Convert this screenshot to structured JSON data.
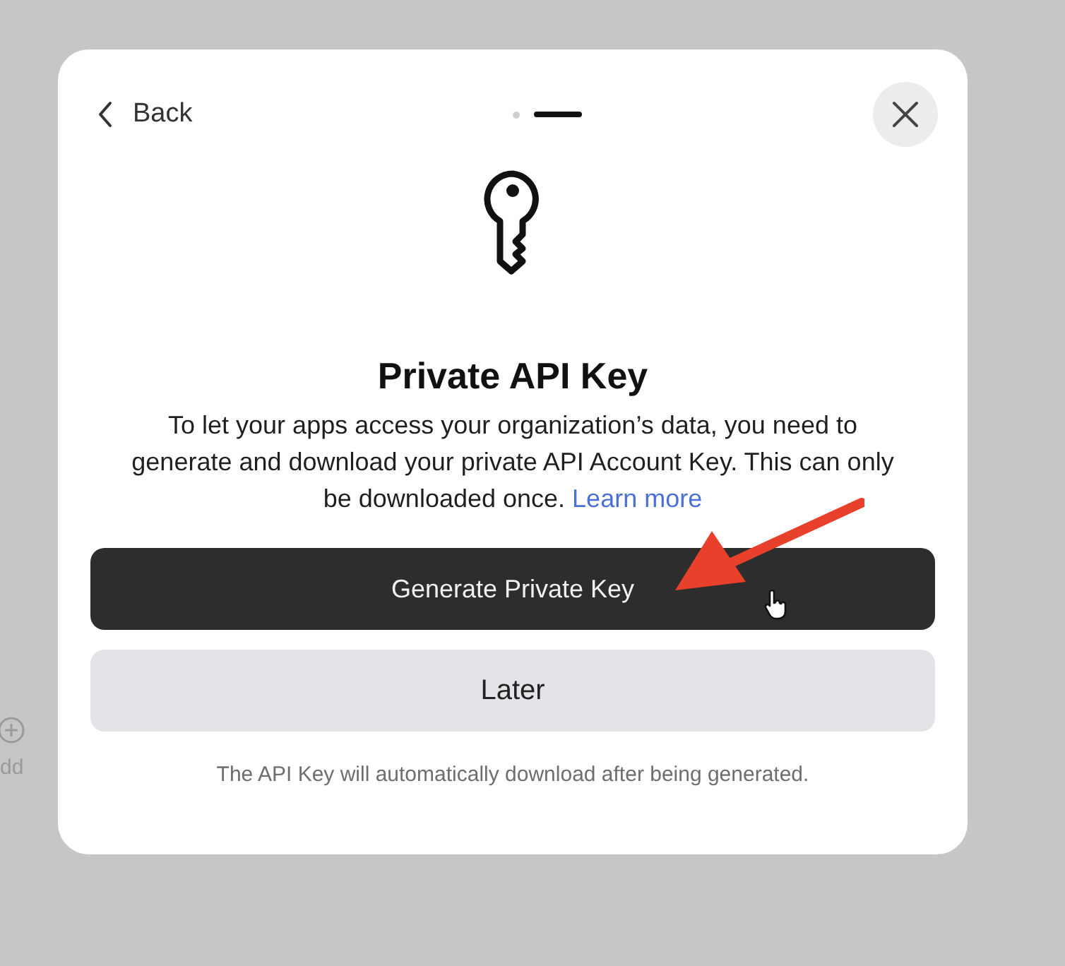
{
  "background": {
    "add_label": "dd"
  },
  "dialog": {
    "back": "Back",
    "steps": [
      {
        "selected": false
      },
      {
        "selected": true
      }
    ],
    "title": "Private API Key",
    "description": "To let your apps access your organization’s data, you need to generate and download your private API Account Key. This can only be downloaded once.",
    "link": "Learn more",
    "primary_button": "Generate Private Key",
    "secondary_button": "Later",
    "footnote": "The API Key will automatically download after being generated."
  }
}
